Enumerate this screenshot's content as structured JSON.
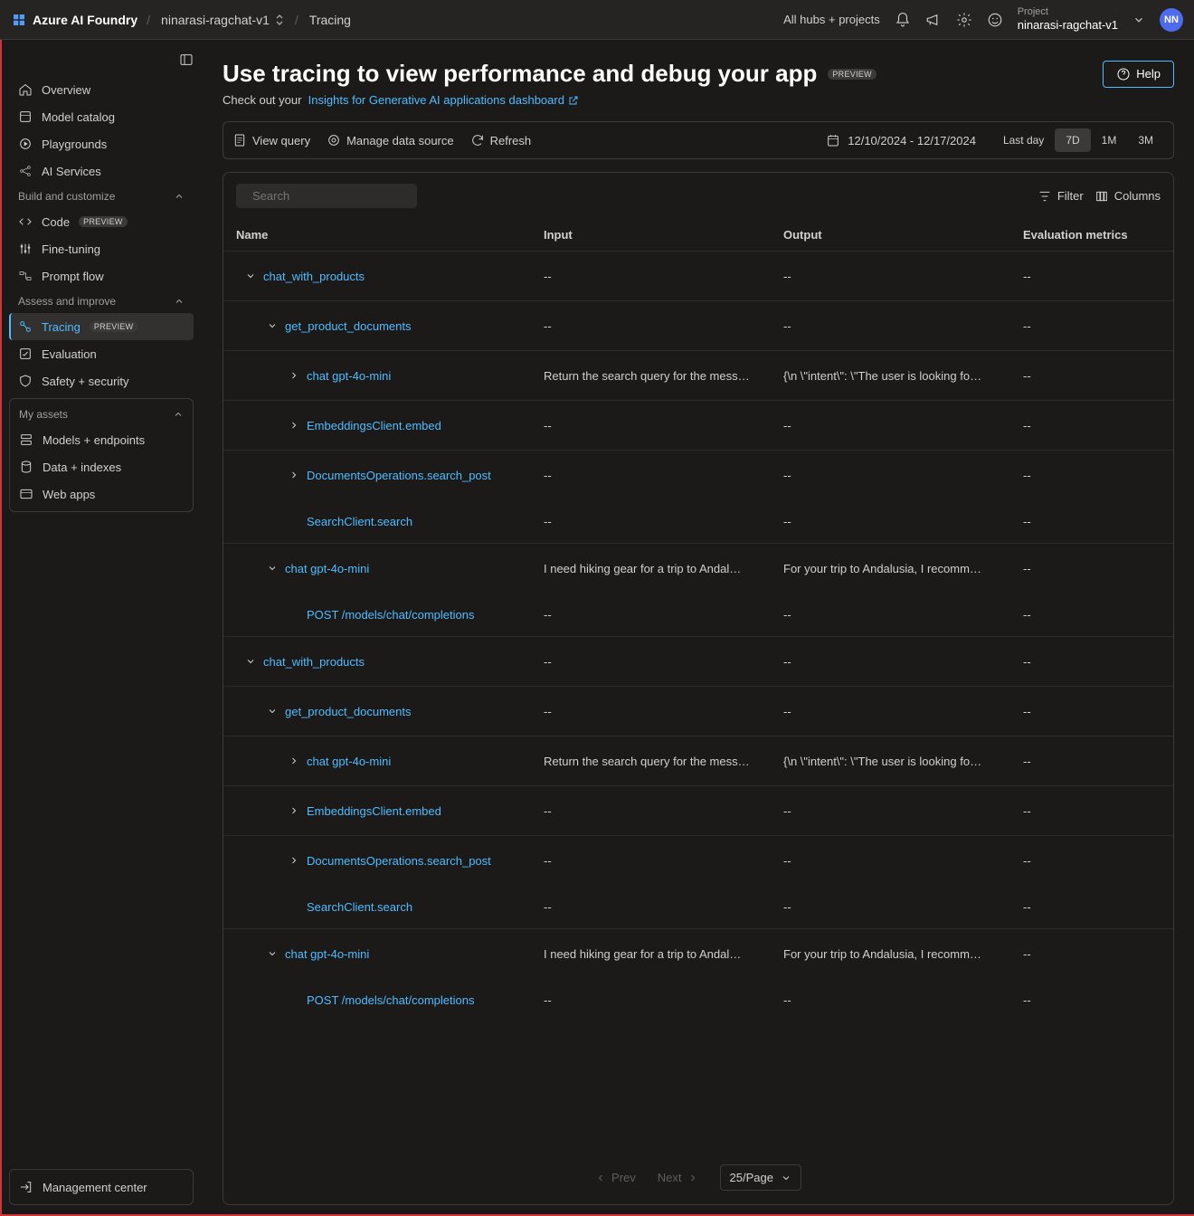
{
  "topbar": {
    "brand": "Azure AI Foundry",
    "breadcrumb": [
      "ninarasi-ragchat-v1",
      "Tracing"
    ],
    "allHubs": "All hubs + projects",
    "projectLabel": "Project",
    "projectName": "ninarasi-ragchat-v1",
    "avatar": "NN"
  },
  "sidebar": {
    "top": [
      {
        "label": "Overview"
      },
      {
        "label": "Model catalog"
      },
      {
        "label": "Playgrounds"
      },
      {
        "label": "AI Services"
      }
    ],
    "buildHdr": "Build and customize",
    "build": [
      {
        "label": "Code",
        "badge": "PREVIEW"
      },
      {
        "label": "Fine-tuning"
      },
      {
        "label": "Prompt flow"
      }
    ],
    "assessHdr": "Assess and improve",
    "assess": [
      {
        "label": "Tracing",
        "badge": "PREVIEW",
        "active": true
      },
      {
        "label": "Evaluation"
      },
      {
        "label": "Safety + security"
      }
    ],
    "assetsHdr": "My assets",
    "assets": [
      {
        "label": "Models + endpoints"
      },
      {
        "label": "Data + indexes"
      },
      {
        "label": "Web apps"
      }
    ],
    "mgmt": "Management center"
  },
  "page": {
    "title": "Use tracing to view performance and debug your app",
    "titleBadge": "PREVIEW",
    "helpLabel": "Help",
    "subtitlePrefix": "Check out your",
    "subtitleLink": "Insights for Generative AI applications dashboard"
  },
  "toolbar": {
    "viewQuery": "View query",
    "manage": "Manage data source",
    "refresh": "Refresh",
    "dateRange": "12/10/2024 - 12/17/2024",
    "ranges": [
      "Last day",
      "7D",
      "1M",
      "3M"
    ],
    "activeRange": "7D"
  },
  "tableHeader": {
    "search": "Search",
    "filter": "Filter",
    "columns": "Columns",
    "cols": [
      "Name",
      "Input",
      "Output",
      "Evaluation metrics"
    ]
  },
  "rows": [
    {
      "indent": 0,
      "chev": "down",
      "name": "chat_with_products",
      "input": "--",
      "output": "--",
      "eval": "--"
    },
    {
      "indent": 1,
      "chev": "down",
      "name": "get_product_documents",
      "input": "--",
      "output": "--",
      "eval": "--"
    },
    {
      "indent": 2,
      "chev": "right",
      "name": "chat gpt-4o-mini",
      "input": "Return the search query for the mess…",
      "output": "{\\n \\\"intent\\\": \\\"The user is looking fo…",
      "eval": "--"
    },
    {
      "indent": 2,
      "chev": "right",
      "name": "EmbeddingsClient.embed",
      "input": "--",
      "output": "--",
      "eval": "--"
    },
    {
      "indent": 2,
      "chev": "right",
      "name": "DocumentsOperations.search_post",
      "input": "--",
      "output": "--",
      "eval": "--"
    },
    {
      "indent": 2,
      "chev": "none",
      "name": "SearchClient.search",
      "input": "--",
      "output": "--",
      "eval": "--",
      "short": true
    },
    {
      "indent": 1,
      "chev": "down",
      "name": "chat gpt-4o-mini",
      "input": "I need hiking gear for a trip to Andal…",
      "output": "For your trip to Andalusia, I recomm…",
      "eval": "--"
    },
    {
      "indent": 2,
      "chev": "none",
      "name": "POST /models/chat/completions",
      "input": "--",
      "output": "--",
      "eval": "--",
      "short": true
    },
    {
      "indent": 0,
      "chev": "down",
      "name": "chat_with_products",
      "input": "--",
      "output": "--",
      "eval": "--"
    },
    {
      "indent": 1,
      "chev": "down",
      "name": "get_product_documents",
      "input": "--",
      "output": "--",
      "eval": "--"
    },
    {
      "indent": 2,
      "chev": "right",
      "name": "chat gpt-4o-mini",
      "input": "Return the search query for the mess…",
      "output": "{\\n \\\"intent\\\": \\\"The user is looking fo…",
      "eval": "--"
    },
    {
      "indent": 2,
      "chev": "right",
      "name": "EmbeddingsClient.embed",
      "input": "--",
      "output": "--",
      "eval": "--"
    },
    {
      "indent": 2,
      "chev": "right",
      "name": "DocumentsOperations.search_post",
      "input": "--",
      "output": "--",
      "eval": "--"
    },
    {
      "indent": 2,
      "chev": "none",
      "name": "SearchClient.search",
      "input": "--",
      "output": "--",
      "eval": "--",
      "short": true
    },
    {
      "indent": 1,
      "chev": "down",
      "name": "chat gpt-4o-mini",
      "input": "I need hiking gear for a trip to Andal…",
      "output": "For your trip to Andalusia, I recomm…",
      "eval": "--"
    },
    {
      "indent": 2,
      "chev": "none",
      "name": "POST /models/chat/completions",
      "input": "--",
      "output": "--",
      "eval": "--",
      "short": true
    }
  ],
  "pager": {
    "prev": "Prev",
    "next": "Next",
    "pageSize": "25/Page"
  }
}
